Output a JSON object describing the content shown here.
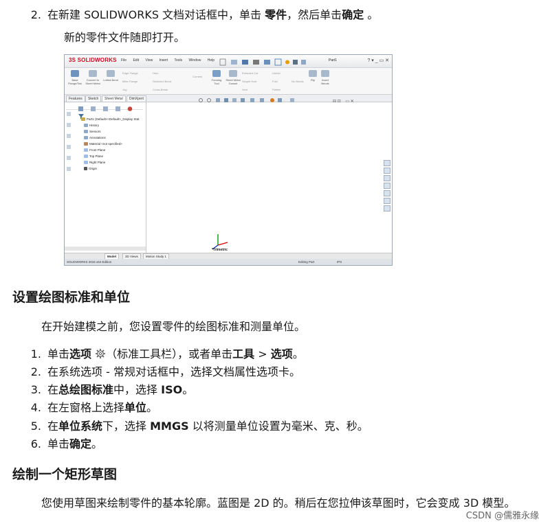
{
  "step2": {
    "num": "2.",
    "a": "在新建 SOLIDWORKS 文档对话框中，单击 ",
    "b1": "零件",
    "c": "，然后单击",
    "b2": "确定",
    "d": " 。"
  },
  "step2_note": "新的零件文件随即打开。",
  "screenshot": {
    "logo": "3S SOLIDWORKS",
    "menu": [
      "File",
      "Edit",
      "View",
      "Insert",
      "Tools",
      "Window",
      "Help"
    ],
    "part_name": "Part1",
    "ribbon_buttons": [
      "Base Flange/Tab",
      "Convert to Sheet Metal",
      "Lofted-Bend",
      "Forming Tool",
      "Sheet Metal Gusset",
      "Rip",
      "Insert Bends"
    ],
    "ribbon_small": [
      "Edge Flange",
      "Miter Flange",
      "Hem",
      "Sketched Bend",
      "Jog",
      "Cross-Break",
      "Extruded Cut",
      "Simple Hole",
      "Vent",
      "Unfold",
      "Fold",
      "Flatten",
      "No Bends",
      "Corners"
    ],
    "tabs": [
      "Features",
      "Sketch",
      "Sheet Metal",
      "DimXpert"
    ],
    "tree_items": [
      "Part1 (Default<<Default>_Display Stat",
      "History",
      "Sensors",
      "Annotations",
      "Material <not specified>",
      "Front Plane",
      "Top Plane",
      "Right Plane",
      "Origin"
    ],
    "view_label": "*Trimetric",
    "bottom_tabs": [
      "Model",
      "3D Views",
      "Motion Study 1"
    ],
    "status_left": "SOLIDWORKS 2016 x64 Edition",
    "status_mid": "Editing Part",
    "status_units": "IPS"
  },
  "section1": {
    "title": "设置绘图标准和单位",
    "intro": "在开始建模之前，您设置零件的绘图标准和测量单位。",
    "steps": [
      {
        "num": "1.",
        "a": "单击",
        "b": "选项",
        "c": "（标准工具栏），或者单击",
        "d": "工具",
        "e": " > ",
        "f": "选项",
        "g": "。"
      },
      {
        "num": "2.",
        "a": "在系统选项 - 常规对话框中，选择文档属性选项卡。"
      },
      {
        "num": "3.",
        "a": "在",
        "b": "总绘图标准",
        "c": "中，选择 ",
        "d": "ISO",
        "e": "。"
      },
      {
        "num": "4.",
        "a": "在左窗格上选择",
        "b": "单位",
        "c": "。"
      },
      {
        "num": "5.",
        "a": "在",
        "b": "单位系统",
        "c": "下，选择 ",
        "d": "MMGS",
        "e": " 以将测量单位设置为毫米、克、秒。"
      },
      {
        "num": "6.",
        "a": "单击",
        "b": "确定",
        "c": "。"
      }
    ]
  },
  "section2": {
    "title": "绘制一个矩形草图",
    "intro": "您使用草图来绘制零件的基本轮廓。蓝图是 2D 的。稍后在您拉伸该草图时，它会变成 3D 模型。"
  },
  "watermark": "CSDN @儒雅永缘",
  "colors": {
    "logo_red": "#d6001c",
    "axis_x": "#d40000",
    "axis_y": "#00a000",
    "axis_z": "#0030d0"
  }
}
